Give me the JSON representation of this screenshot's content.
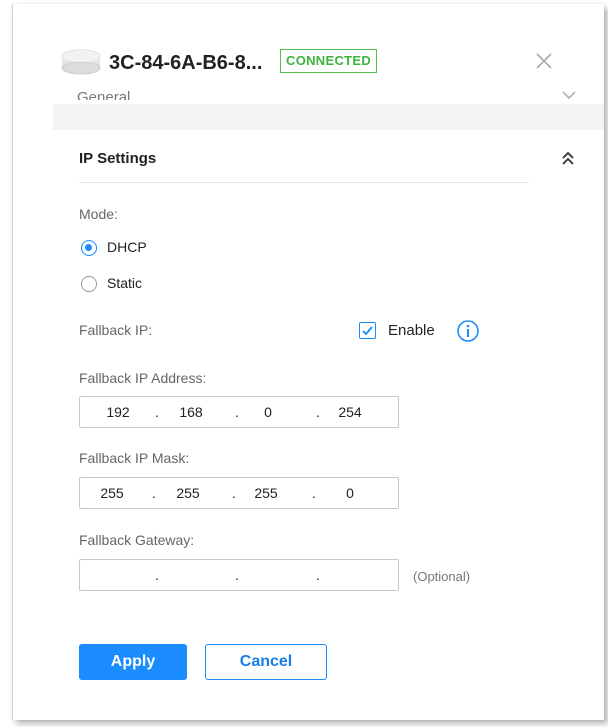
{
  "header": {
    "device_name": "3C-84-6A-B6-8...",
    "status": "CONNECTED",
    "status_color": "#3cb43c",
    "icons": {
      "device": "device-icon",
      "close": "close-icon"
    }
  },
  "general_section": {
    "label": "General",
    "icon": "chevron-down-icon"
  },
  "ip_settings": {
    "title": "IP Settings",
    "collapse_icon": "double-chevron-up-icon",
    "mode_label": "Mode:",
    "mode_options": [
      {
        "label": "DHCP",
        "selected": true
      },
      {
        "label": "Static",
        "selected": false
      }
    ],
    "fallback_ip_label": "Fallback IP:",
    "enable_label": "Enable",
    "enable_checked": true,
    "info_icon": "info-icon",
    "fallback_address": {
      "label": "Fallback IP Address:",
      "octets": [
        "192",
        "168",
        "0",
        "254"
      ]
    },
    "fallback_mask": {
      "label": "Fallback IP Mask:",
      "octets": [
        "255",
        "255",
        "255",
        "0"
      ]
    },
    "fallback_gateway": {
      "label": "Fallback Gateway:",
      "octets": [
        "",
        "",
        "",
        ""
      ],
      "hint": "(Optional)"
    }
  },
  "actions": {
    "apply": "Apply",
    "cancel": "Cancel"
  },
  "colors": {
    "accent": "#1a8cff",
    "connected": "#3cb43c"
  }
}
